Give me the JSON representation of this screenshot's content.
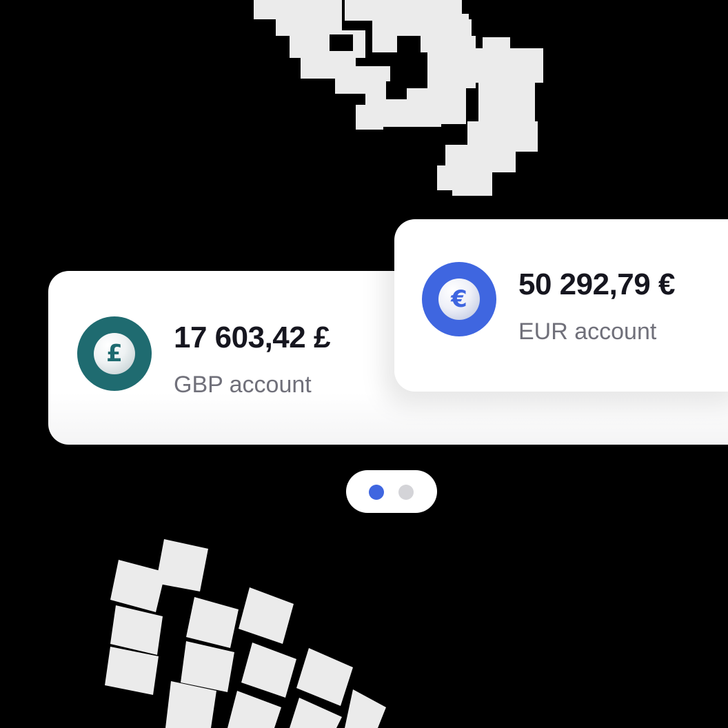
{
  "accounts": [
    {
      "currency_symbol": "£",
      "amount": "17 603,42 £",
      "label": "GBP account",
      "coin_color": "#1f6b70",
      "icon": "pound-coin-icon"
    },
    {
      "currency_symbol": "€",
      "amount": "50 292,79 €",
      "label": "EUR account",
      "coin_color": "#3f66e0",
      "icon": "euro-coin-icon"
    }
  ],
  "pagination": {
    "total_pages": 2,
    "active_page": 1,
    "active_color": "#3f66e0",
    "inactive_color": "#d4d4d8"
  },
  "colors": {
    "background": "#000000",
    "card": "#ffffff",
    "decoration": "#ebebeb",
    "amount_text": "#16161f",
    "label_text": "#70707a"
  }
}
